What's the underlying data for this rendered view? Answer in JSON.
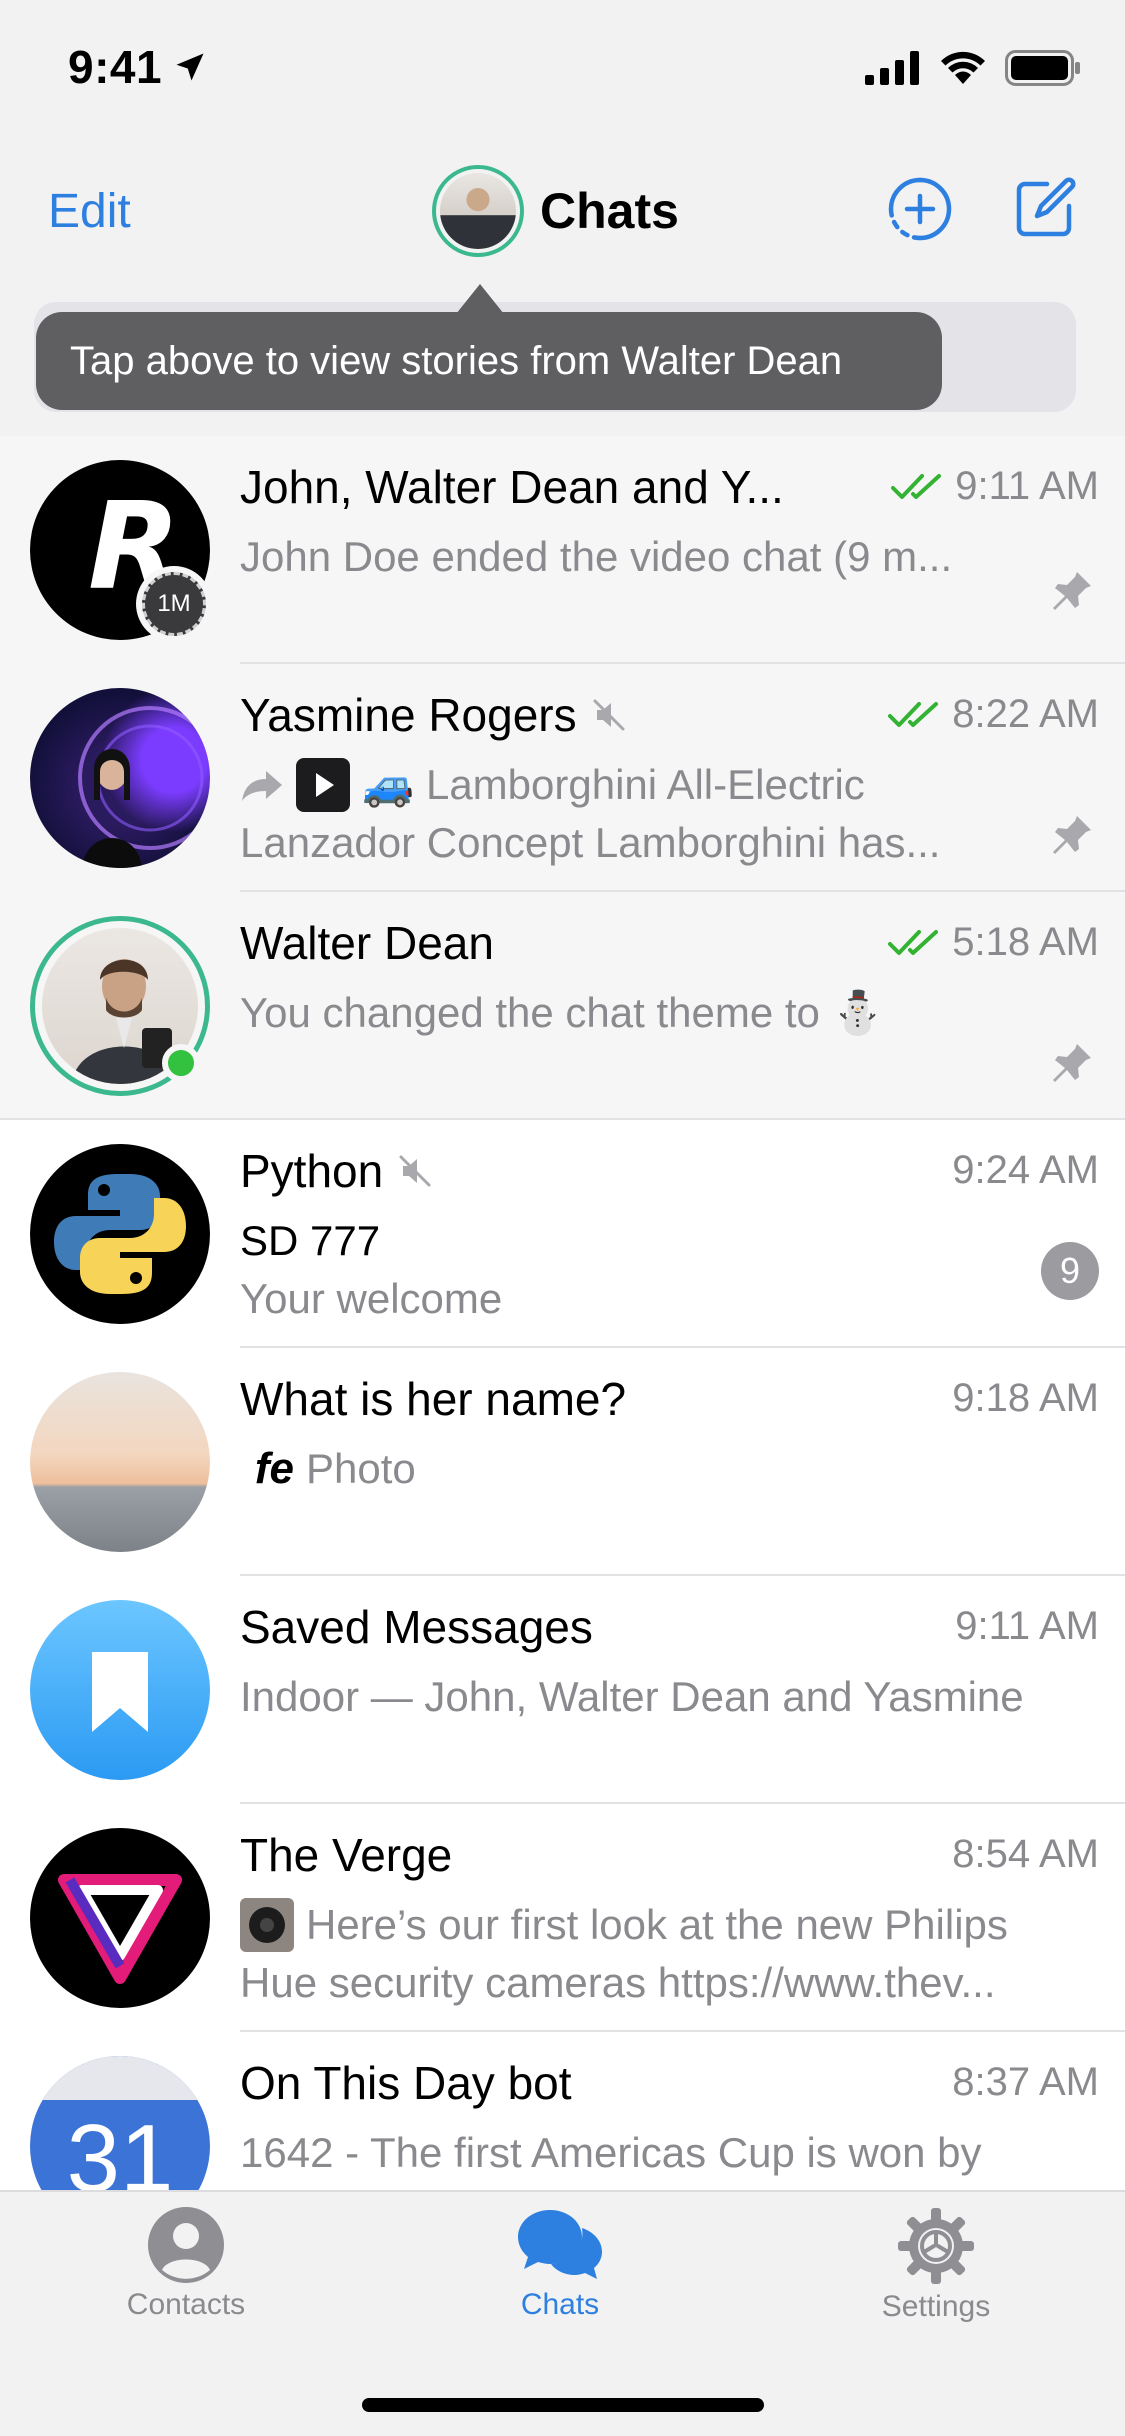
{
  "status_bar": {
    "time": "9:41"
  },
  "nav": {
    "edit_label": "Edit",
    "title": "Chats"
  },
  "tooltip": {
    "text": "Tap above to view stories from Walter Dean"
  },
  "chats": [
    {
      "name": "John, Walter Dean and Y...",
      "time": "9:11 AM",
      "read": true,
      "pinned": true,
      "story_label": "1M",
      "preview": [
        "John Doe ended the video chat (9 m..."
      ]
    },
    {
      "name": "Yasmine Rogers",
      "muted": true,
      "time": "8:22 AM",
      "read": true,
      "pinned": true,
      "preview": [
        "🚙 Lamborghini All-Electric",
        "Lanzador Concept Lamborghini has..."
      ]
    },
    {
      "name": "Walter Dean",
      "time": "5:18 AM",
      "read": true,
      "pinned": true,
      "online": true,
      "preview": [
        "You changed the chat theme to ⛄"
      ]
    },
    {
      "name": "Python",
      "muted": true,
      "time": "9:24 AM",
      "sender": "SD 777",
      "preview": [
        "Your welcome"
      ],
      "unread_count": "9"
    },
    {
      "name": "What is her name?",
      "time": "9:18 AM",
      "media_thumb": "fe",
      "preview": [
        "Photo"
      ]
    },
    {
      "name": "Saved Messages",
      "time": "9:11 AM",
      "preview": [
        "Indoor — John, Walter Dean and Yasmine"
      ]
    },
    {
      "name": "The Verge",
      "time": "8:54 AM",
      "preview": [
        "Here’s our first look at the new Philips",
        "Hue security cameras https://www.thev..."
      ]
    },
    {
      "name": "On This Day bot",
      "time": "8:37 AM",
      "calendar_day": "31",
      "preview": [
        "1642 - The first Americas Cup is won by"
      ]
    }
  ],
  "tabs": [
    {
      "label": "Contacts",
      "icon": "person-circle-icon"
    },
    {
      "label": "Chats",
      "icon": "chat-bubbles-icon",
      "active": true
    },
    {
      "label": "Settings",
      "icon": "gear-icon"
    }
  ],
  "colors": {
    "accent": "#2d7fe0",
    "read_check": "#34b233",
    "online": "#33c23f",
    "story_ring": "#3cb88e"
  }
}
